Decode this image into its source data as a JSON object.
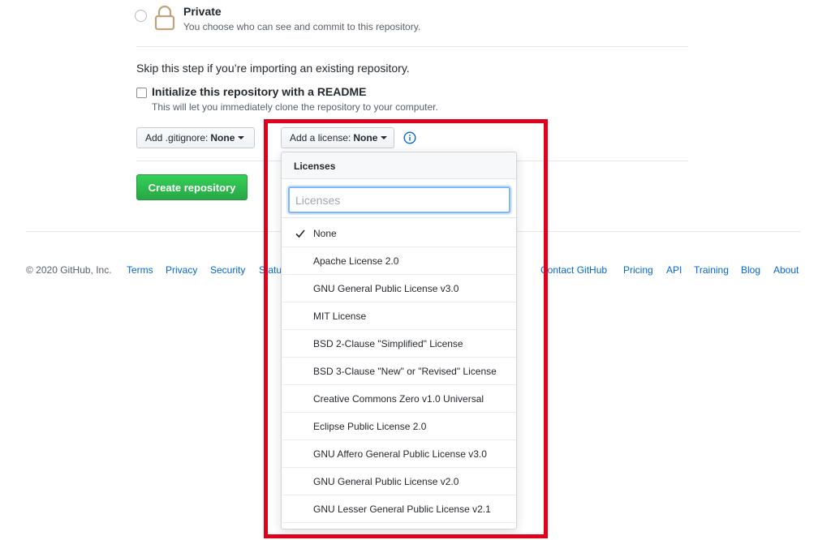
{
  "visibility": {
    "private_title": "Private",
    "private_description": "You choose who can see and commit to this repository."
  },
  "skip_text": "Skip this step if you’re importing an existing repository.",
  "initialize": {
    "title": "Initialize this repository with a README",
    "description": "This will let you immediately clone the repository to your computer."
  },
  "gitignore": {
    "label": "Add .gitignore:",
    "value": "None"
  },
  "license": {
    "label": "Add a license:",
    "value": "None"
  },
  "create_button": "Create repository",
  "dropdown": {
    "header": "Licenses",
    "filter_placeholder": "Licenses",
    "items": [
      {
        "label": "None",
        "selected": true
      },
      {
        "label": "Apache License 2.0"
      },
      {
        "label": "GNU General Public License v3.0"
      },
      {
        "label": "MIT License"
      },
      {
        "label": "BSD 2-Clause \"Simplified\" License"
      },
      {
        "label": "BSD 3-Clause \"New\" or \"Revised\" License"
      },
      {
        "label": "Creative Commons Zero v1.0 Universal"
      },
      {
        "label": "Eclipse Public License 2.0"
      },
      {
        "label": "GNU Affero General Public License v3.0"
      },
      {
        "label": "GNU General Public License v2.0"
      },
      {
        "label": "GNU Lesser General Public License v2.1"
      }
    ]
  },
  "footer": {
    "copyright": "© 2020 GitHub, Inc.",
    "left_links": [
      "Terms",
      "Privacy",
      "Security",
      "Status"
    ],
    "right_links": [
      "Contact GitHub",
      "Pricing",
      "API",
      "Training",
      "Blog",
      "About"
    ]
  },
  "colors": {
    "link": "#0366d6",
    "create_button": "#28a745",
    "highlight_frame": "#e0001b"
  }
}
